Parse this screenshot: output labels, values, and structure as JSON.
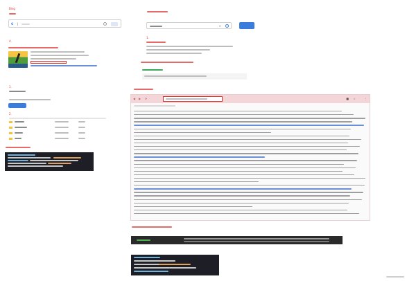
{
  "left": {
    "heading_prefix": "Bing",
    "search": {
      "g_glyph": "G",
      "cursor": "|"
    },
    "step_label": "4.",
    "result_title": "[ ] 3  [ ]",
    "section_label": "1.",
    "section_sub": "[ ]",
    "button_label": "[ ]",
    "section3_label": "2.",
    "table": [
      [
        "C:",
        "D:",
        "3"
      ],
      [
        "C:",
        "D:",
        "3"
      ],
      [
        "C:",
        "D:",
        "3"
      ],
      [
        "C:",
        "D:",
        "3"
      ]
    ],
    "code_label": "3. [ ]"
  },
  "right": {
    "top_label": "[ ] [ ]",
    "search_value": "[ ]",
    "search_clear": "×",
    "search_button": "[ ]",
    "result_step": "1.",
    "result_link": "[ ]",
    "section2_label": "[ ]",
    "section2_link": "[ ]",
    "section3_label": "[ ]",
    "section4_label": "[ ]",
    "toolbar_icons": [
      "◀",
      "▶",
      "⟳"
    ],
    "toolbar_right_icons": [
      "■",
      "☆",
      "⋮"
    ]
  },
  "footer": {
    "watermark": "©[ ]"
  },
  "colors": {
    "accent_red": "#e0332f",
    "accent_blue": "#3b7ddd",
    "code_bg": "#1e1f26",
    "pink": "#f4d6d9"
  }
}
